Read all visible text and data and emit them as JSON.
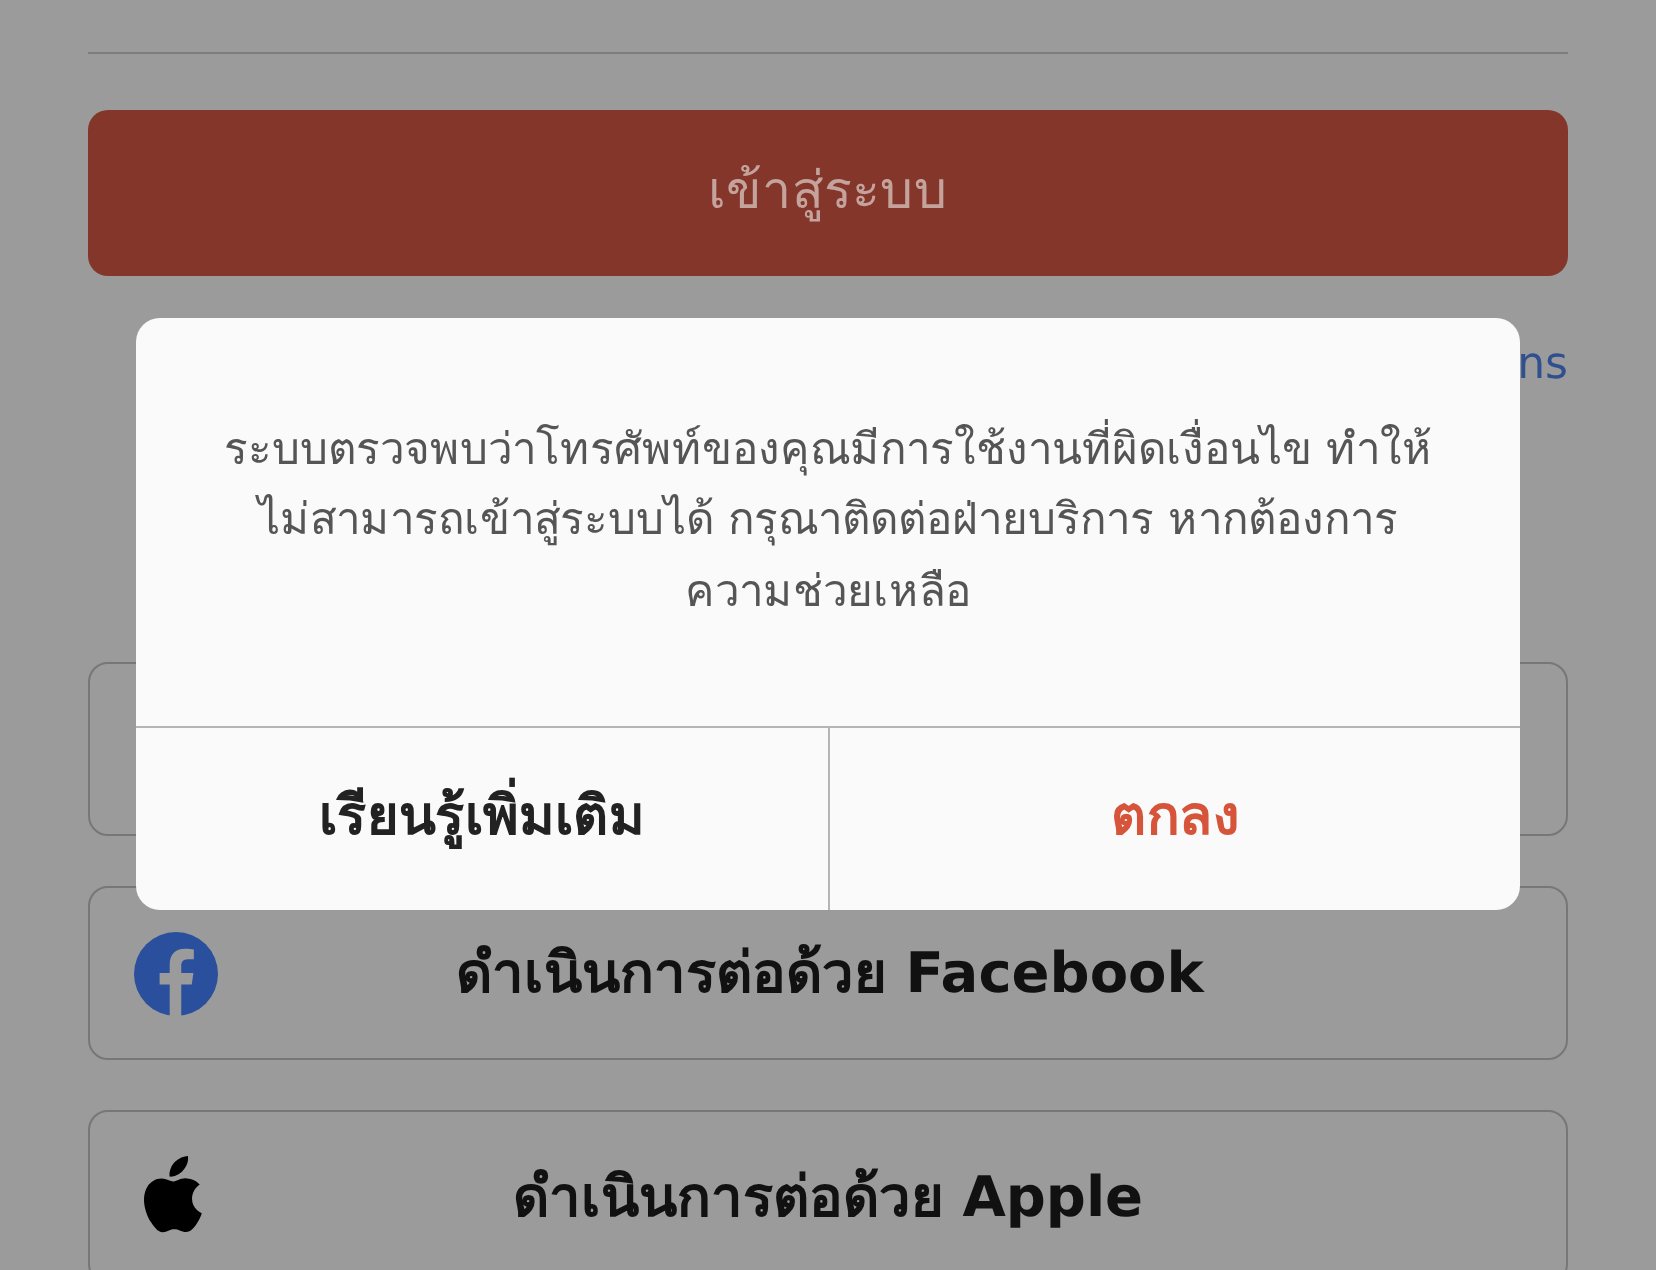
{
  "login_button": {
    "label": "เข้าสู่ระบบ"
  },
  "link": {
    "label": "ns"
  },
  "social_buttons": [
    {
      "kind": "blank"
    },
    {
      "kind": "facebook",
      "label": "ดำเนินการต่อด้วย Facebook"
    },
    {
      "kind": "apple",
      "label": "ดำเนินการต่อด้วย Apple"
    }
  ],
  "alert": {
    "message": "ระบบตรวจพบว่าโทรศัพท์ของคุณมีการใช้งานที่ผิดเงื่อนไข ทำให้ไม่สามารถเข้าสู่ระบบได้ กรุณาติดต่อฝ่ายบริการ หากต้องการความช่วยเหลือ",
    "buttons": [
      {
        "label": "เรียนรู้เพิ่มเติม",
        "kind": "default"
      },
      {
        "label": "ตกลง",
        "kind": "primary"
      }
    ]
  }
}
